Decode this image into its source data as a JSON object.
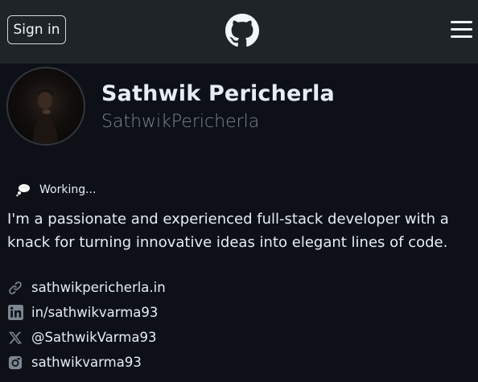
{
  "header": {
    "signin_label": "Sign in",
    "logo_icon": "github-mark-icon",
    "menu_icon": "hamburger-menu-icon"
  },
  "profile": {
    "name": "Sathwik Pericherla",
    "login": "SathwikPericherla",
    "status_icon": "thought-balloon-icon",
    "status_text": "Working...",
    "bio": "I'm a passionate and experienced full-stack developer with a knack for turning innovative ideas into elegant lines of code."
  },
  "links": [
    {
      "icon": "link-icon",
      "text": "sathwikpericherla.in"
    },
    {
      "icon": "linkedin-icon",
      "text": "in/sathwikvarma93"
    },
    {
      "icon": "x-twitter-icon",
      "text": "@SathwikVarma93"
    },
    {
      "icon": "instagram-icon",
      "text": "sathwikvarma93"
    }
  ],
  "colors": {
    "background": "#0d1117",
    "header_bg": "#1f2429",
    "text": "#e6edf3",
    "muted": "#7d8590"
  }
}
